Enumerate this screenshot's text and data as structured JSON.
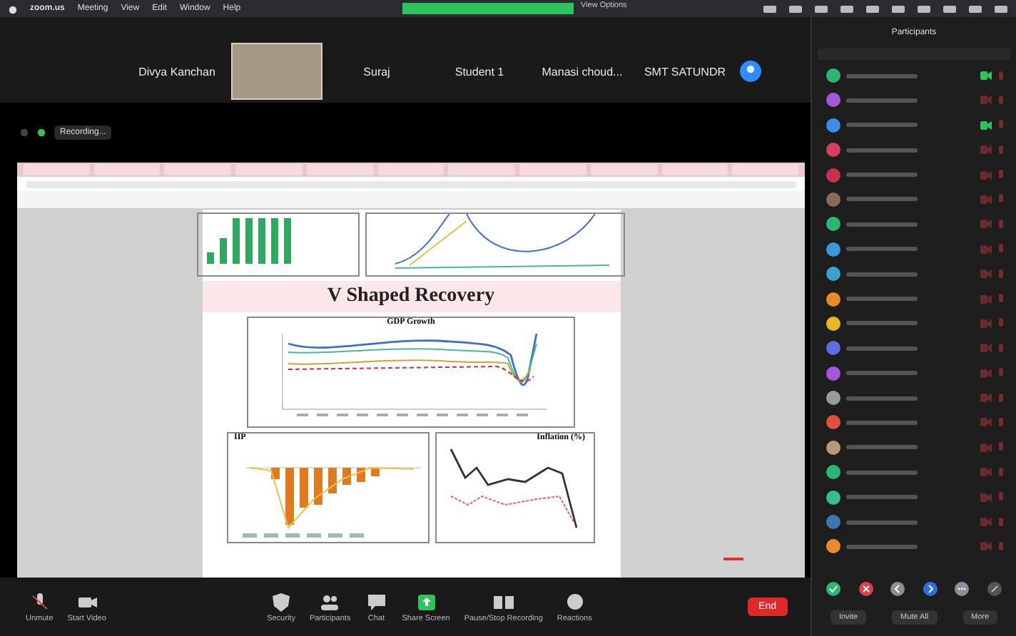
{
  "menubar": {
    "items": [
      "zoom.us",
      "Meeting",
      "View",
      "Edit",
      "Window",
      "Help"
    ]
  },
  "share_banner": {
    "view_options": "View Options"
  },
  "gallery": {
    "tiles": [
      {
        "kind": "name",
        "name": "Divya Kanchan"
      },
      {
        "kind": "video"
      },
      {
        "kind": "name",
        "name": "Suraj"
      },
      {
        "kind": "name",
        "name": "Student 1"
      },
      {
        "kind": "name",
        "name": "Manasi choud..."
      },
      {
        "kind": "name",
        "name": "SMT SATUNDR"
      },
      {
        "kind": "avatar",
        "color": "#2d8cff"
      }
    ]
  },
  "recording": {
    "label": "Recording..."
  },
  "shared_document": {
    "title": "V Shaped Recovery",
    "charts": [
      {
        "kind": "gdp",
        "title": "GDP Growth"
      },
      {
        "kind": "iip",
        "title": "IIP"
      },
      {
        "kind": "inflation",
        "title": "Inflation (%)"
      }
    ]
  },
  "toolbar": {
    "items": [
      {
        "kind": "mic",
        "label": "Unmute"
      },
      {
        "kind": "video",
        "label": "Start Video"
      },
      {
        "kind": "security",
        "label": "Security"
      },
      {
        "kind": "participants",
        "label": "Participants"
      },
      {
        "kind": "chat",
        "label": "Chat"
      },
      {
        "kind": "share",
        "label": "Share Screen"
      },
      {
        "kind": "record",
        "label": "Pause/Stop Recording"
      },
      {
        "kind": "reactions",
        "label": "Reactions"
      }
    ],
    "end": "End"
  },
  "participants": {
    "title": "Participants",
    "rows": [
      {
        "color": "#2bb673",
        "video": true
      },
      {
        "color": "#a259d9",
        "video": false
      },
      {
        "color": "#3a8ee6",
        "video": true
      },
      {
        "color": "#d4405e",
        "video": false
      },
      {
        "color": "#c9304f",
        "video": false
      },
      {
        "color": "#8a6a5a",
        "video": false
      },
      {
        "color": "#2bb673",
        "video": false
      },
      {
        "color": "#3a9ad9",
        "video": false
      },
      {
        "color": "#3aa0d0",
        "video": false
      },
      {
        "color": "#e98a2a",
        "video": false
      },
      {
        "color": "#e8b923",
        "video": false
      },
      {
        "color": "#5b6ee1",
        "video": false
      },
      {
        "color": "#a259d9",
        "video": false
      },
      {
        "color": "#9a9a9a",
        "video": false
      },
      {
        "color": "#e0533a",
        "video": false
      },
      {
        "color": "#b89a7a",
        "video": false
      },
      {
        "color": "#2bb673",
        "video": false
      },
      {
        "color": "#33c08a",
        "video": false
      },
      {
        "color": "#3a78b0",
        "video": false
      },
      {
        "color": "#e98a2a",
        "video": false
      }
    ],
    "reactions": [
      {
        "kind": "yes",
        "color": "#2bb673"
      },
      {
        "kind": "no",
        "color": "#e0404a"
      },
      {
        "kind": "slower",
        "color": "#8a8f99"
      },
      {
        "kind": "faster",
        "color": "#2d6fe0"
      },
      {
        "kind": "more",
        "color": "#8a8f99"
      },
      {
        "kind": "clear",
        "color": "#555555"
      }
    ],
    "buttons": [
      "Invite",
      "Mute All",
      "More"
    ]
  }
}
